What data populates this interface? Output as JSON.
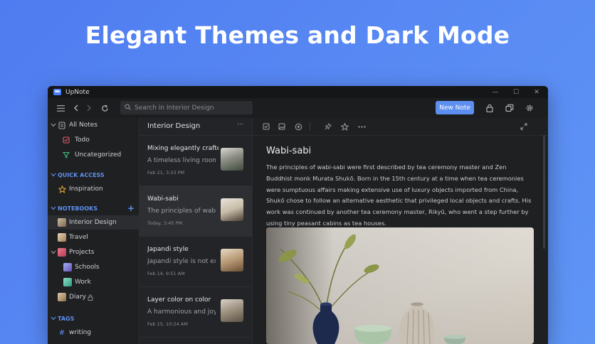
{
  "headline": "Elegant Themes and Dark Mode",
  "window": {
    "app_title": "UpNote",
    "controls": {
      "minimize": "—",
      "maximize": "☐",
      "close": "✕"
    }
  },
  "toolbar": {
    "search_placeholder": "Search in Interior Design",
    "new_note_label": "New Note",
    "icons": [
      "menu-icon",
      "back-icon",
      "forward-icon",
      "refresh-icon",
      "search-icon",
      "lock-icon",
      "windows-icon",
      "gear-icon"
    ]
  },
  "sidebar": {
    "all_notes": "All Notes",
    "todo": "Todo",
    "uncategorized": "Uncategorized",
    "quick_access_header": "QUICK ACCESS",
    "inspiration": "Inspiration",
    "notebooks_header": "NOTEBOOKS",
    "notebooks": [
      {
        "label": "Interior Design",
        "active": true
      },
      {
        "label": "Travel"
      },
      {
        "label": "Projects"
      },
      {
        "label": "Schools"
      },
      {
        "label": "Work"
      },
      {
        "label": "Diary"
      }
    ],
    "tags_header": "TAGS",
    "tag_writing": "writing"
  },
  "notelist": {
    "title": "Interior Design",
    "more": "···",
    "notes": [
      {
        "title": "Mixing elegantly crafte...",
        "snippet": "A timeless living room ...",
        "date": "Feb 21, 3:33 PM"
      },
      {
        "title": "Wabi-sabi",
        "snippet": "The principles of wabi-...",
        "date": "Today, 3:45 PM",
        "selected": true
      },
      {
        "title": "Japandi style",
        "snippet": "Japandi style is not exa...",
        "date": "Feb 14, 9:51 AM"
      },
      {
        "title": "Layer color on color",
        "snippet": "A harmonious and joyf...",
        "date": "Feb 15, 10:24 AM"
      }
    ]
  },
  "editor": {
    "title": "Wabi-sabi",
    "body": "The principles of wabi-sabi were first described by tea ceremony master and Zen Buddhist monk Murata Shukō. Born in the 15th century at a time when tea ceremonies were sumptuous affairs making extensive use of luxury objects imported from China, Shukō chose to follow an alternative aesthetic that privileged local objects and crafts. His work was continued by another tea ceremony master, Rikyū, who went a step further by using tiny peasant cabins as tea houses."
  },
  "colors": {
    "accent": "#5d8ff0",
    "background": "#5a8cf4",
    "window": "#1f2022"
  }
}
